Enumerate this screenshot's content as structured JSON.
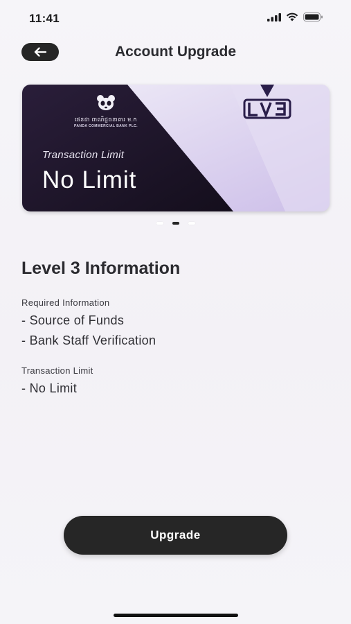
{
  "status_bar": {
    "time": "11:41"
  },
  "header": {
    "title": "Account Upgrade"
  },
  "card": {
    "bank_name_kh": "ផេនដា ពាណិជ្ជធនាគារ ម.ក",
    "bank_name_en": "PANDA COMMERCIAL BANK PLC.",
    "limit_label": "Transaction Limit",
    "limit_value": "No Limit",
    "level_badge": "LV3"
  },
  "carousel": {
    "count": 3,
    "active_index": 1
  },
  "info": {
    "title": "Level 3 Information",
    "required_label": "Required Information",
    "required_items": [
      "- Source of Funds",
      "- Bank Staff Verification"
    ],
    "limit_label": "Transaction Limit",
    "limit_items": [
      "- No Limit"
    ]
  },
  "actions": {
    "upgrade_label": "Upgrade"
  },
  "colors": {
    "dark": "#262626",
    "card_dark": "#1e1628",
    "card_light": "#ddd4f0",
    "badge": "#2a1e4a"
  }
}
